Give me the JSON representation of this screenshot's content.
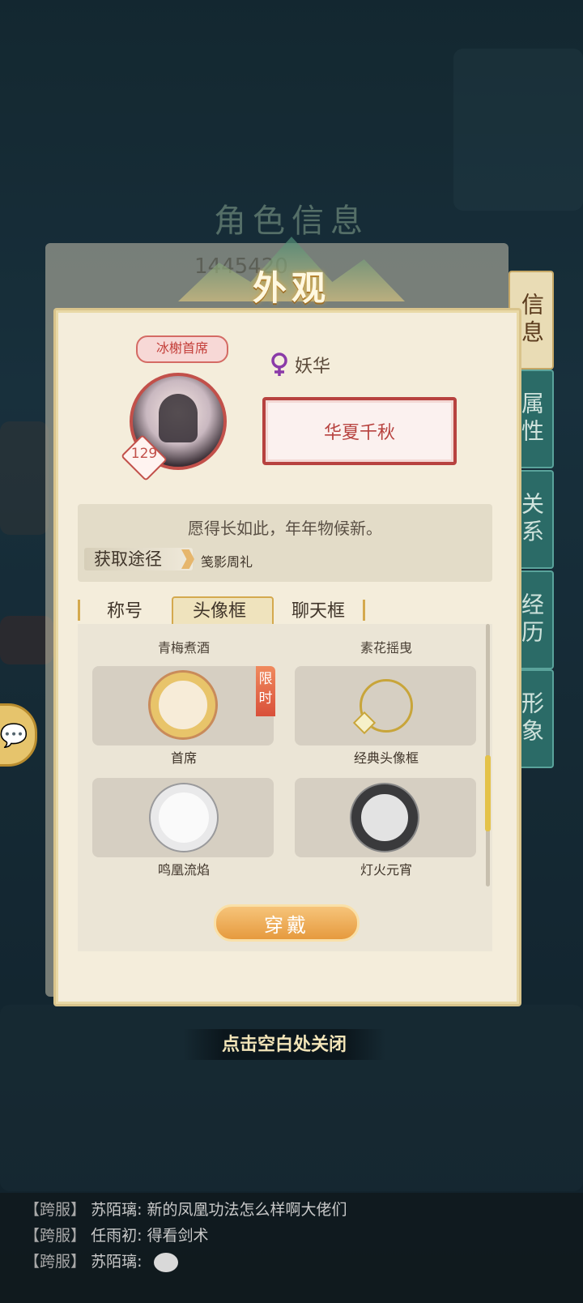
{
  "underlying": {
    "panel_title": "角色信息",
    "id_text": "1445420",
    "side_tabs": [
      "信息",
      "属性",
      "关系",
      "经历",
      "形象"
    ]
  },
  "modal": {
    "title": "外观",
    "badge": "冰榭首席",
    "level": "129",
    "name": "妖华",
    "title_plaque": "华夏千秋",
    "quote": "愿得长如此，年年物候新。",
    "source_label": "获取途径",
    "source_value": "笺影周礼",
    "tabs": [
      "称号",
      "头像框",
      "聊天框"
    ],
    "active_tab": "头像框",
    "groups": [
      "青梅煮酒",
      "素花摇曳"
    ],
    "items": [
      "首席",
      "经典头像框",
      "鸣凰流焰",
      "灯火元宵"
    ],
    "limited_tag": "限时",
    "wear_button": "穿戴"
  },
  "close_hint": "点击空白处关闭",
  "chat": [
    {
      "channel": "【跨服】",
      "text": "苏陌璃: 新的凤凰功法怎么样啊大佬们"
    },
    {
      "channel": "【跨服】",
      "text": "任雨初: 得看剑术"
    },
    {
      "channel": "【跨服】",
      "text": "苏陌璃:"
    }
  ],
  "colors": {
    "accent_red": "#b7423f",
    "accent_gold": "#d4a94e",
    "button_orange": "#e69a3e",
    "side_tab_teal": "#2b6b67"
  }
}
